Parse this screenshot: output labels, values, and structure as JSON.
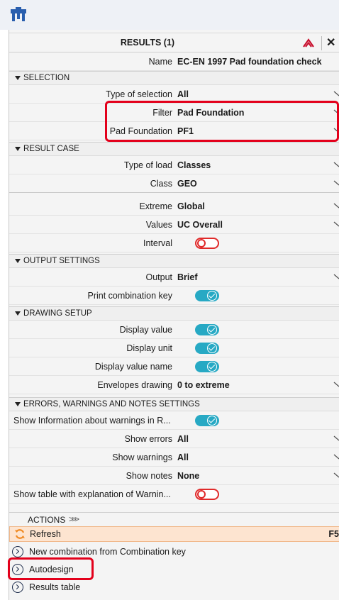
{
  "panel": {
    "title": "RESULTS (1)",
    "name_label": "Name",
    "name_value": "EC-EN 1997 Pad foundation check"
  },
  "sections": {
    "selection": "SELECTION",
    "result_case": "RESULT CASE",
    "output_settings": "OUTPUT SETTINGS",
    "drawing_setup": "DRAWING SETUP",
    "errors": "ERRORS, WARNINGS AND NOTES SETTINGS"
  },
  "selection": {
    "type_label": "Type of selection",
    "type_value": "All",
    "filter_label": "Filter",
    "filter_value": "Pad Foundation",
    "pad_label": "Pad Foundation",
    "pad_value": "PF1"
  },
  "result_case": {
    "load_label": "Type of load",
    "load_value": "Classes",
    "class_label": "Class",
    "class_value": "GEO",
    "extreme_label": "Extreme",
    "extreme_value": "Global",
    "values_label": "Values",
    "values_value": "UC Overall",
    "interval_label": "Interval",
    "interval_on": false
  },
  "output": {
    "output_label": "Output",
    "output_value": "Brief",
    "print_label": "Print combination key",
    "print_on": true
  },
  "drawing": {
    "display_value_label": "Display value",
    "display_value_on": true,
    "display_unit_label": "Display unit",
    "display_unit_on": true,
    "display_name_label": "Display value name",
    "display_name_on": true,
    "envelopes_label": "Envelopes drawing",
    "envelopes_value": "0 to extreme"
  },
  "errors": {
    "show_info_label": "Show Information about warnings in R...",
    "show_info_on": true,
    "errors_label": "Show errors",
    "errors_value": "All",
    "warnings_label": "Show warnings",
    "warnings_value": "All",
    "notes_label": "Show notes",
    "notes_value": "None",
    "table_label": "Show table with explanation of Warnin...",
    "table_on": false
  },
  "actions": {
    "title": "ACTIONS",
    "refresh": "Refresh",
    "refresh_shortcut": "F5",
    "new_combination": "New combination from Combination key",
    "autodesign": "Autodesign",
    "results_table": "Results table"
  },
  "colors": {
    "accent": "#27a9c4",
    "highlight": "#e3001b",
    "refresh_bg": "#fde4d0"
  }
}
